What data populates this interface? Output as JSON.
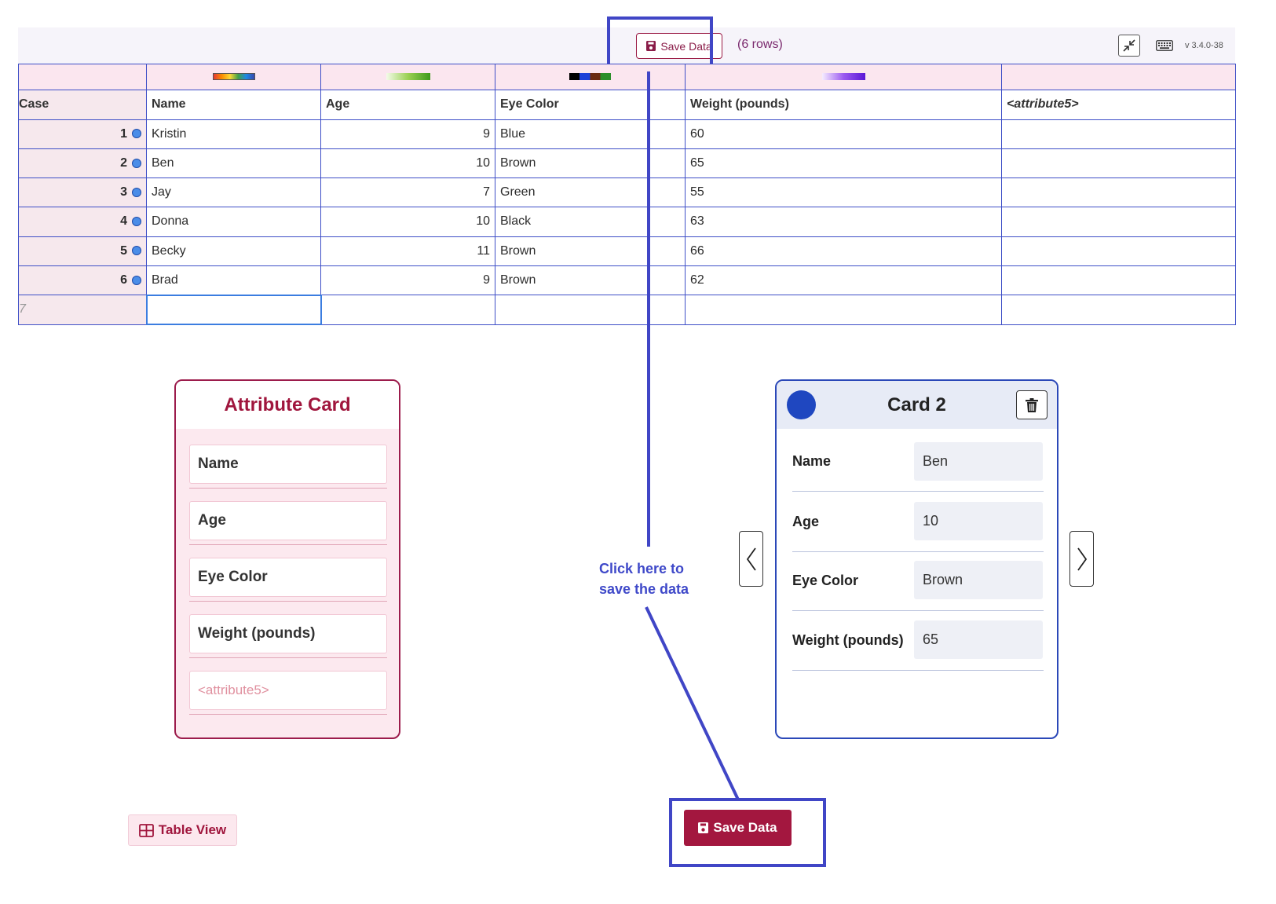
{
  "toolbar": {
    "save_label": "Save Data",
    "row_count": "(6 rows)",
    "version": "v 3.4.0-38"
  },
  "grid": {
    "case_header": "Case",
    "columns": [
      "Name",
      "Age",
      "Eye Color",
      "Weight (pounds)",
      "<attribute5>"
    ],
    "rows": [
      {
        "case": "1",
        "name": "Kristin",
        "age": "9",
        "eye": "Blue",
        "weight": "60"
      },
      {
        "case": "2",
        "name": "Ben",
        "age": "10",
        "eye": "Brown",
        "weight": "65"
      },
      {
        "case": "3",
        "name": "Jay",
        "age": "7",
        "eye": "Green",
        "weight": "55"
      },
      {
        "case": "4",
        "name": "Donna",
        "age": "10",
        "eye": "Black",
        "weight": "63"
      },
      {
        "case": "5",
        "name": "Becky",
        "age": "11",
        "eye": "Brown",
        "weight": "66"
      },
      {
        "case": "6",
        "name": "Brad",
        "age": "9",
        "eye": "Brown",
        "weight": "62"
      }
    ],
    "new_row_index": "7"
  },
  "attribute_card": {
    "title": "Attribute Card",
    "fields": [
      "Name",
      "Age",
      "Eye Color",
      "Weight (pounds)",
      "<attribute5>"
    ]
  },
  "record_card": {
    "title": "Card 2",
    "fields": [
      {
        "label": "Name",
        "value": "Ben"
      },
      {
        "label": "Age",
        "value": "10"
      },
      {
        "label": "Eye Color",
        "value": "Brown"
      },
      {
        "label": "Weight (pounds)",
        "value": "65"
      }
    ]
  },
  "annotation": {
    "line1": "Click here to",
    "line2": "save the data"
  },
  "bottom": {
    "table_view_label": "Table View",
    "save_label": "Save Data"
  },
  "colors": {
    "accent": "#a3173f",
    "highlight": "#4046c6",
    "card_blue": "#1f47c0",
    "grid_border": "#3e4fc7"
  }
}
